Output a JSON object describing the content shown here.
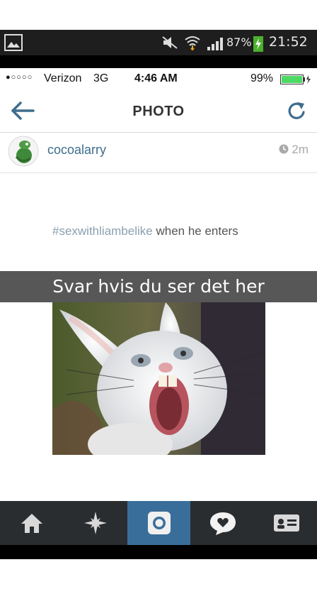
{
  "android_status": {
    "battery": "87%",
    "time": "21:52"
  },
  "ios_status": {
    "carrier": "Verizon",
    "network": "3G",
    "time": "4:46 AM",
    "battery": "99%"
  },
  "nav": {
    "title": "PHOTO",
    "back_icon": "back-arrow-icon",
    "refresh_icon": "refresh-icon"
  },
  "post": {
    "username": "cocoalarry",
    "time_ago": "2m",
    "caption_tag": "#sexwithliambelike",
    "caption_text": " when he enters",
    "overlay_text": "Svar hvis du ser det her"
  },
  "tabs": [
    {
      "icon": "home-icon"
    },
    {
      "icon": "explore-icon"
    },
    {
      "icon": "camera-icon"
    },
    {
      "icon": "activity-icon"
    },
    {
      "icon": "profile-icon"
    }
  ],
  "colors": {
    "accent": "#3f6d8e",
    "tab_active": "#3a6e9a",
    "tabbar": "#2a2d30"
  }
}
